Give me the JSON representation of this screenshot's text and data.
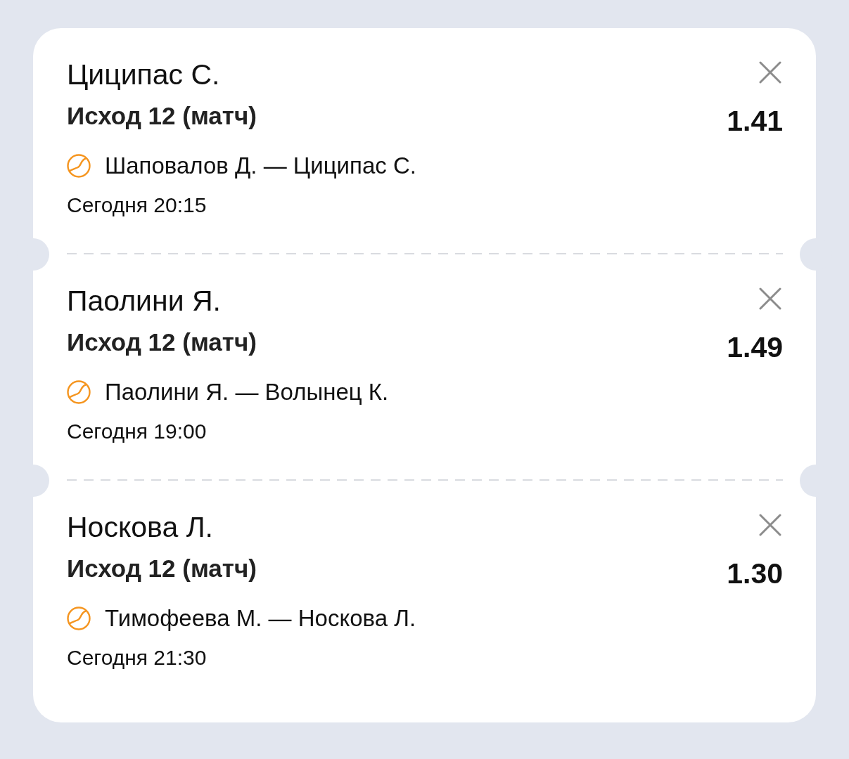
{
  "bets": [
    {
      "player": "Циципас С.",
      "market": "Исход 12 (матч)",
      "odds": "1.41",
      "match": "Шаповалов Д. — Циципас С.",
      "time": "Сегодня 20:15"
    },
    {
      "player": "Паолини Я.",
      "market": "Исход 12 (матч)",
      "odds": "1.49",
      "match": "Паолини Я. — Волынец К.",
      "time": "Сегодня 19:00"
    },
    {
      "player": "Носкова Л.",
      "market": "Исход 12 (матч)",
      "odds": "1.30",
      "match": "Тимофеева М. — Носкова Л.",
      "time": "Сегодня 21:30"
    }
  ]
}
